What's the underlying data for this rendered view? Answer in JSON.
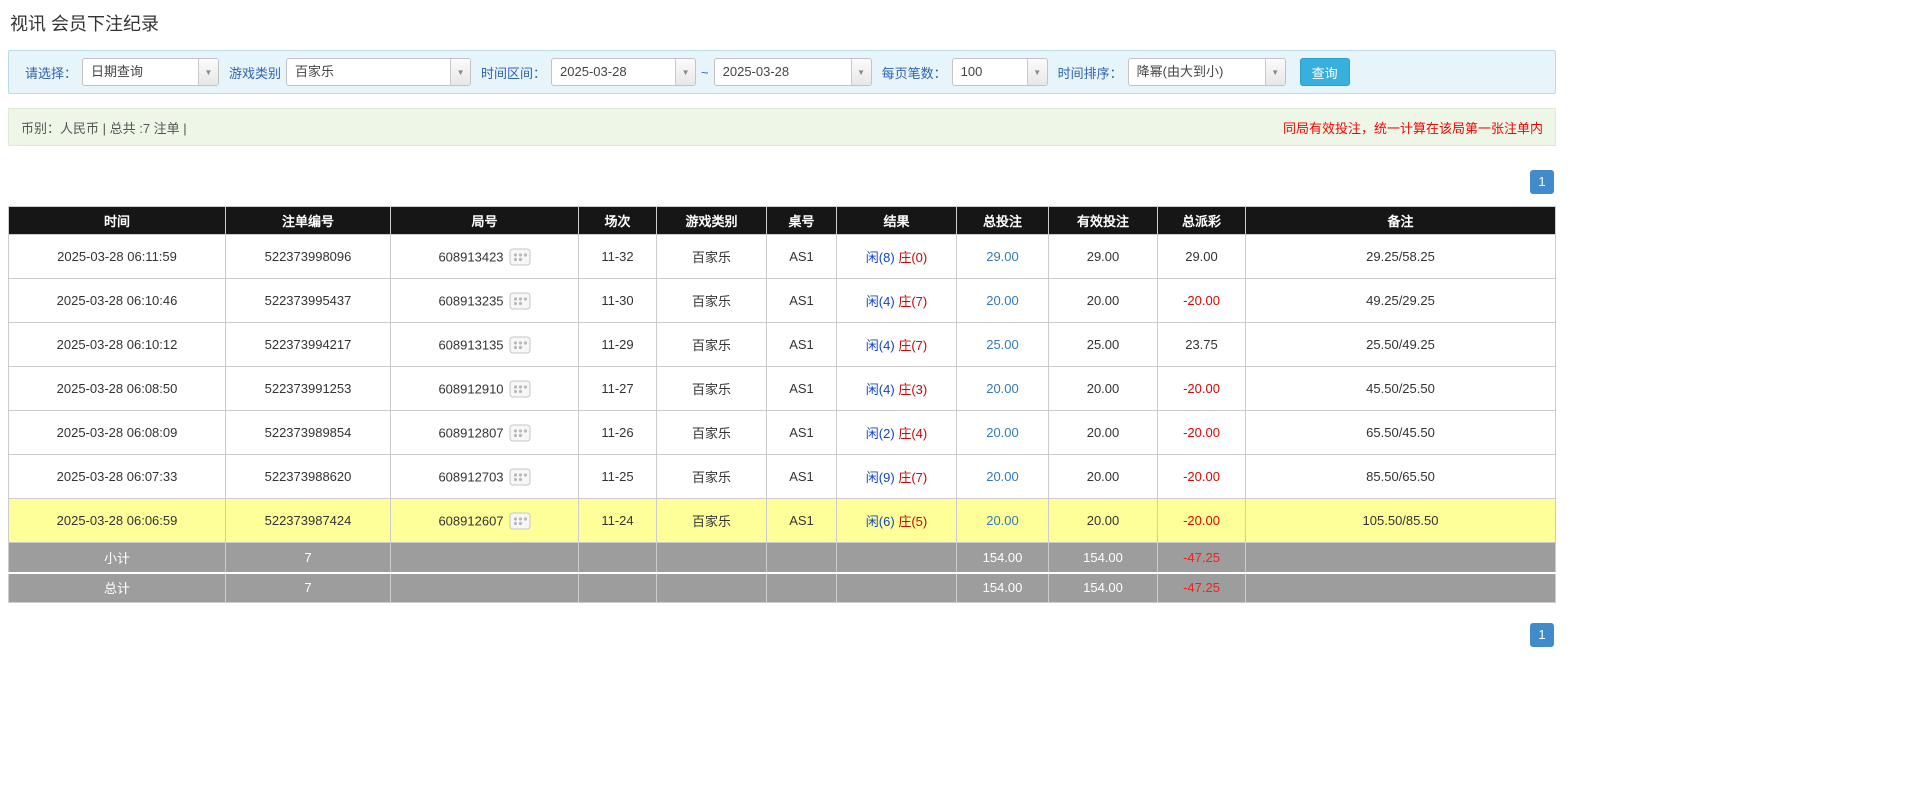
{
  "page": {
    "title": "视讯 会员下注纪录"
  },
  "filter_bar": {
    "select": {
      "label": "请选择：",
      "value": "日期查询"
    },
    "game_type": {
      "label": "游戏类别",
      "value": "百家乐"
    },
    "time_range": {
      "label": "时间区间：",
      "from": "2025-03-28",
      "separator": "~",
      "to": "2025-03-28"
    },
    "page_size": {
      "label": "每页笔数：",
      "value": "100"
    },
    "sort": {
      "label": "时间排序：",
      "value": "降幂(由大到小)"
    },
    "search_button": "查询"
  },
  "summary_bar": {
    "currency_info": "币别：人民币 | 总共 :7 注单 |",
    "notice": "同局有效投注，统一计算在该局第一张注单内"
  },
  "pagination": {
    "current_page": "1"
  },
  "colors": {
    "header_bg": "#161616",
    "highlight_row": "#ffff99",
    "footer_gray": "#9d9d9d",
    "link_blue": "#337ab7",
    "player_blue": "#1144cc",
    "banker_red": "#d40000",
    "negative_red": "#e60000",
    "button_blue": "#38b0dd",
    "pagination_blue": "#428bca",
    "filter_bar_bg": "#e7f4fa",
    "summary_bar_bg": "#eef7e7"
  },
  "icons": {
    "combo_arrow": "chevron-down-icon",
    "round_icon": "roadmap-icon"
  },
  "table": {
    "headers": [
      "时间",
      "注单编号",
      "局号",
      "场次",
      "游戏类别",
      "桌号",
      "结果",
      "总投注",
      "有效投注",
      "总派彩",
      "备注"
    ],
    "rows": [
      {
        "time": "2025-03-28 06:11:59",
        "bet_id": "522373998096",
        "round_id": "608913423",
        "session": "11-32",
        "game_type": "百家乐",
        "table_no": "AS1",
        "result_player": "闲(8)",
        "result_banker": "庄(0)",
        "total_bet": "29.00",
        "valid_bet": "29.00",
        "payout": "29.00",
        "note": "29.25/58.25",
        "highlighted": false
      },
      {
        "time": "2025-03-28 06:10:46",
        "bet_id": "522373995437",
        "round_id": "608913235",
        "session": "11-30",
        "game_type": "百家乐",
        "table_no": "AS1",
        "result_player": "闲(4)",
        "result_banker": "庄(7)",
        "total_bet": "20.00",
        "valid_bet": "20.00",
        "payout": "-20.00",
        "note": "49.25/29.25",
        "highlighted": false
      },
      {
        "time": "2025-03-28 06:10:12",
        "bet_id": "522373994217",
        "round_id": "608913135",
        "session": "11-29",
        "game_type": "百家乐",
        "table_no": "AS1",
        "result_player": "闲(4)",
        "result_banker": "庄(7)",
        "total_bet": "25.00",
        "valid_bet": "25.00",
        "payout": "23.75",
        "note": "25.50/49.25",
        "highlighted": false
      },
      {
        "time": "2025-03-28 06:08:50",
        "bet_id": "522373991253",
        "round_id": "608912910",
        "session": "11-27",
        "game_type": "百家乐",
        "table_no": "AS1",
        "result_player": "闲(4)",
        "result_banker": "庄(3)",
        "total_bet": "20.00",
        "valid_bet": "20.00",
        "payout": "-20.00",
        "note": "45.50/25.50",
        "highlighted": false
      },
      {
        "time": "2025-03-28 06:08:09",
        "bet_id": "522373989854",
        "round_id": "608912807",
        "session": "11-26",
        "game_type": "百家乐",
        "table_no": "AS1",
        "result_player": "闲(2)",
        "result_banker": "庄(4)",
        "total_bet": "20.00",
        "valid_bet": "20.00",
        "payout": "-20.00",
        "note": "65.50/45.50",
        "highlighted": false
      },
      {
        "time": "2025-03-28 06:07:33",
        "bet_id": "522373988620",
        "round_id": "608912703",
        "session": "11-25",
        "game_type": "百家乐",
        "table_no": "AS1",
        "result_player": "闲(9)",
        "result_banker": "庄(7)",
        "total_bet": "20.00",
        "valid_bet": "20.00",
        "payout": "-20.00",
        "note": "85.50/65.50",
        "highlighted": false
      },
      {
        "time": "2025-03-28 06:06:59",
        "bet_id": "522373987424",
        "round_id": "608912607",
        "session": "11-24",
        "game_type": "百家乐",
        "table_no": "AS1",
        "result_player": "闲(6)",
        "result_banker": "庄(5)",
        "total_bet": "20.00",
        "valid_bet": "20.00",
        "payout": "-20.00",
        "note": "105.50/85.50",
        "highlighted": true
      }
    ],
    "subtotal_row": {
      "label": "小计",
      "count": "7",
      "total_bet": "154.00",
      "valid_bet": "154.00",
      "payout": "-47.25"
    },
    "total_row": {
      "label": "总计",
      "count": "7",
      "total_bet": "154.00",
      "valid_bet": "154.00",
      "payout": "-47.25"
    }
  }
}
